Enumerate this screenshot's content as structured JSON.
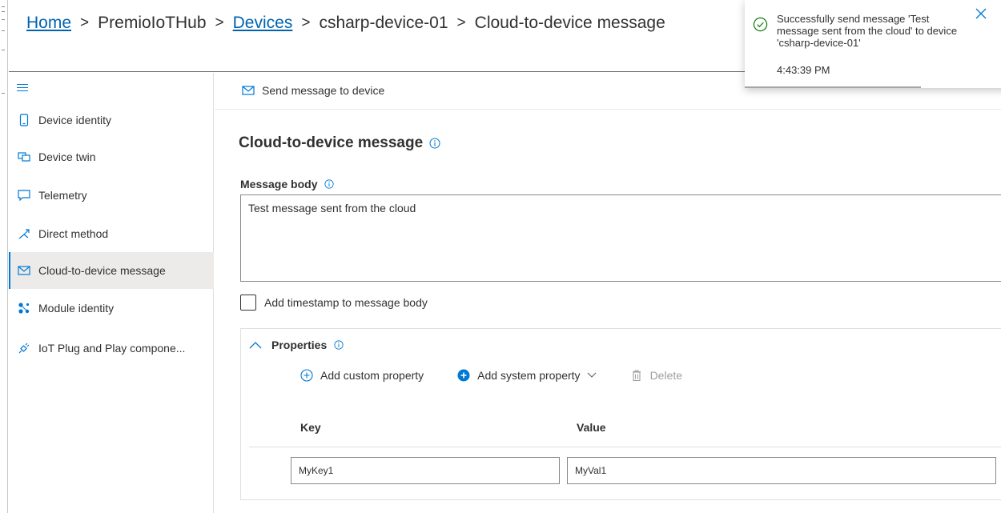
{
  "breadcrumb": {
    "home": "Home",
    "hub": "PremioIoTHub",
    "devices": "Devices",
    "device": "csharp-device-01",
    "page": "Cloud-to-device message",
    "separator": ">"
  },
  "toast": {
    "message": "Successfully send message 'Test message sent from the cloud' to device 'csharp-device-01'",
    "time": "4:43:39 PM",
    "icon": "checkmark-circle-icon",
    "accent": "#107c10"
  },
  "sidebar": {
    "items": [
      {
        "label": "Device identity",
        "icon": "phone-icon"
      },
      {
        "label": "Device twin",
        "icon": "device-twin-icon"
      },
      {
        "label": "Telemetry",
        "icon": "chat-icon"
      },
      {
        "label": "Direct method",
        "icon": "direct-method-icon"
      },
      {
        "label": "Cloud-to-device message",
        "icon": "mail-icon",
        "active": true
      },
      {
        "label": "Module identity",
        "icon": "module-icon"
      },
      {
        "label": "IoT Plug and Play compone...",
        "icon": "plug-icon"
      }
    ]
  },
  "commandbar": {
    "send_label": "Send message to device"
  },
  "main": {
    "title": "Cloud-to-device message",
    "message_body_label": "Message body",
    "message_body_value": "Test message sent from the cloud",
    "timestamp_label": "Add timestamp to message body",
    "timestamp_checked": false
  },
  "properties": {
    "header": "Properties",
    "add_custom": "Add custom property",
    "add_system": "Add system property",
    "delete": "Delete",
    "key_header": "Key",
    "value_header": "Value",
    "rows": [
      {
        "key": "MyKey1",
        "value": "MyVal1"
      }
    ]
  },
  "colors": {
    "link": "#0063b1",
    "accent": "#0078d4",
    "active_bg": "#edebe9"
  }
}
